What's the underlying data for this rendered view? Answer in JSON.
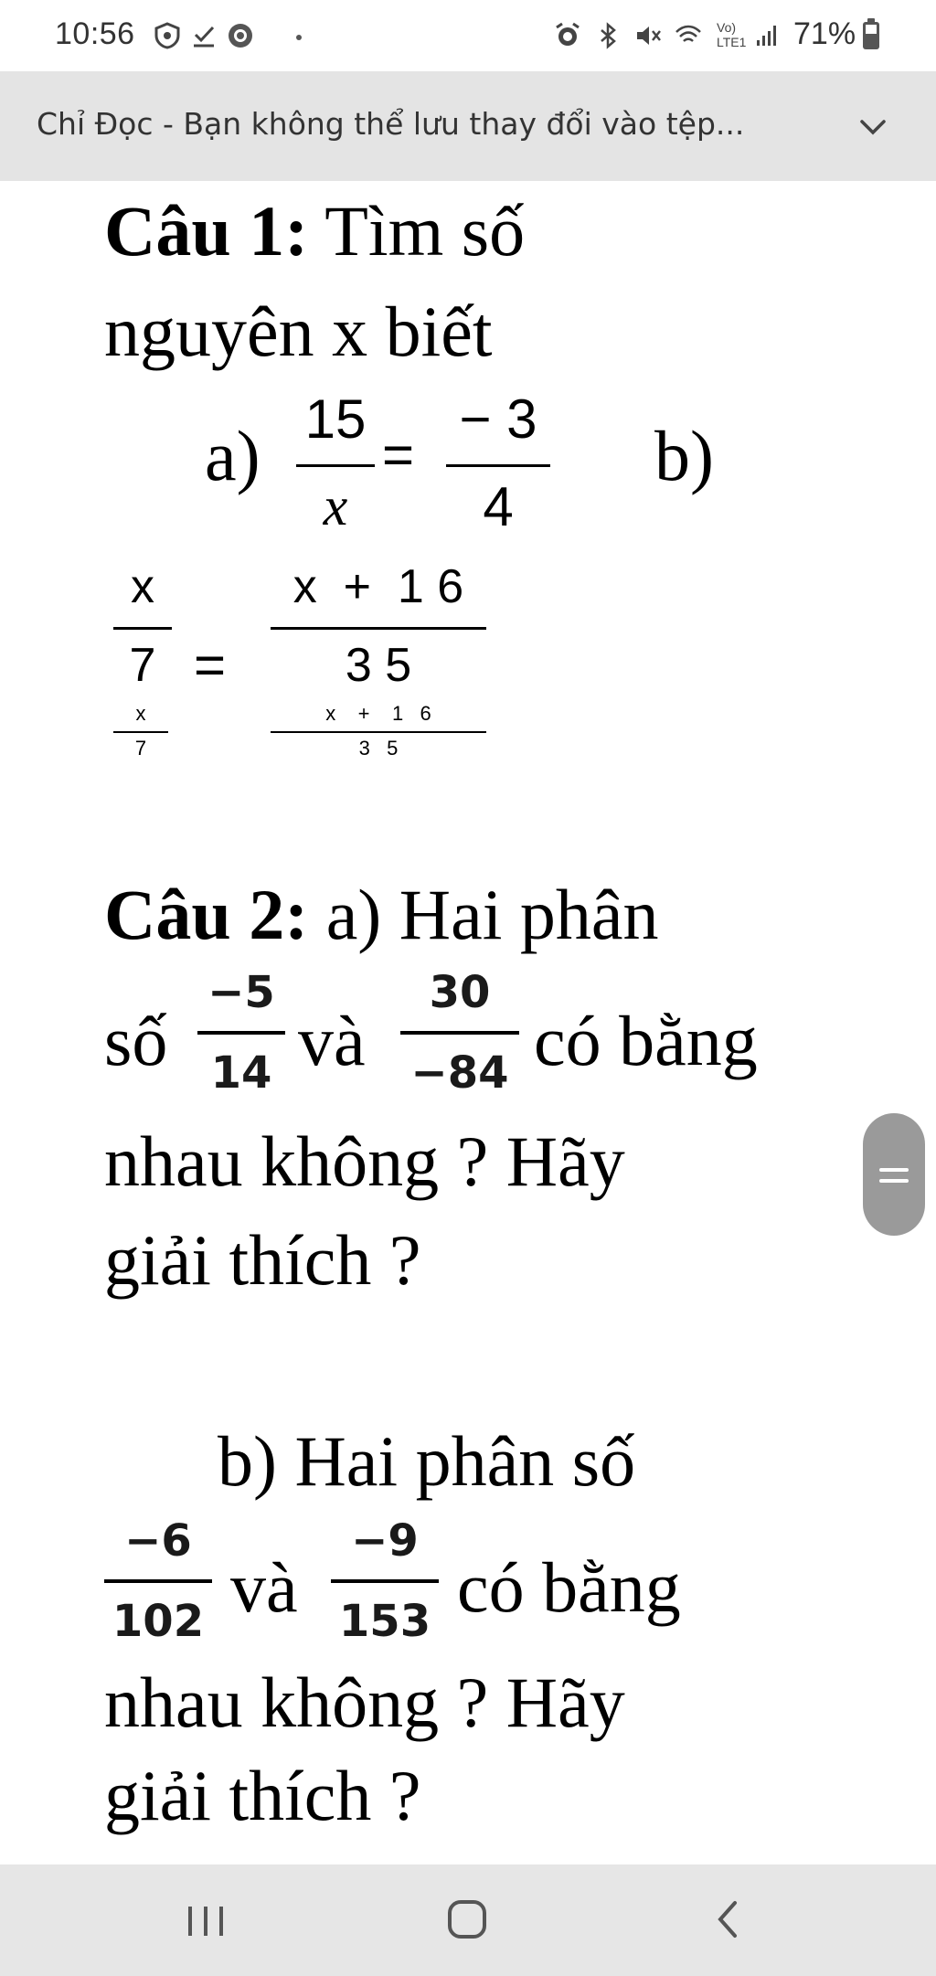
{
  "status_bar": {
    "time": "10:56",
    "battery_percent": "71%",
    "network_label": "Vo) LTE1",
    "icons": [
      "shield-icon",
      "download-done-icon",
      "chrome-icon",
      "dot-icon",
      "alarm-icon",
      "bluetooth-icon",
      "mute-icon",
      "wifi-icon",
      "volte-icon",
      "signal-icon",
      "battery-icon"
    ]
  },
  "banner": {
    "text": "Chỉ Đọc - Bạn không thể lưu thay đổi vào tệp...",
    "chevron": "chevron-down-icon"
  },
  "document": {
    "q1": {
      "label": "Câu 1:",
      "line1": " Tìm số",
      "line2": "nguyên x biết",
      "part_a": "a)",
      "part_b": "b)",
      "eq_a": {
        "left_num": "15",
        "left_den": "x",
        "equals": "=",
        "right_num": "− 3",
        "right_den": "4"
      },
      "eq_b": {
        "left_num": "x",
        "left_den": "7",
        "equals": "=",
        "right_num": "x  +  1 6",
        "right_den": "3 5"
      },
      "eq_b_small": {
        "left_num": "x",
        "left_den": "7",
        "right_num": "x    +    1   6",
        "right_den": "3   5"
      }
    },
    "q2": {
      "label": "Câu 2:",
      "line1": " a) Hai phân",
      "line2_pre": "số",
      "frac1": {
        "num": "−5",
        "den": "14"
      },
      "and": "và",
      "frac2": {
        "num": "30",
        "den": "−84"
      },
      "line2_post": "có bằng",
      "line3": "nhau không ? Hãy",
      "line4": "giải thích ?",
      "line5": "b) Hai phân số",
      "frac3": {
        "num": "−6",
        "den": "102"
      },
      "and2": "và",
      "frac4": {
        "num": "−9",
        "den": "153"
      },
      "line6_post": "có bằng",
      "line7": "nhau không ? Hãy",
      "line8": "giải thích ?"
    }
  },
  "nav_bar": {
    "buttons": [
      "recent-apps-icon",
      "home-icon",
      "back-icon"
    ]
  }
}
